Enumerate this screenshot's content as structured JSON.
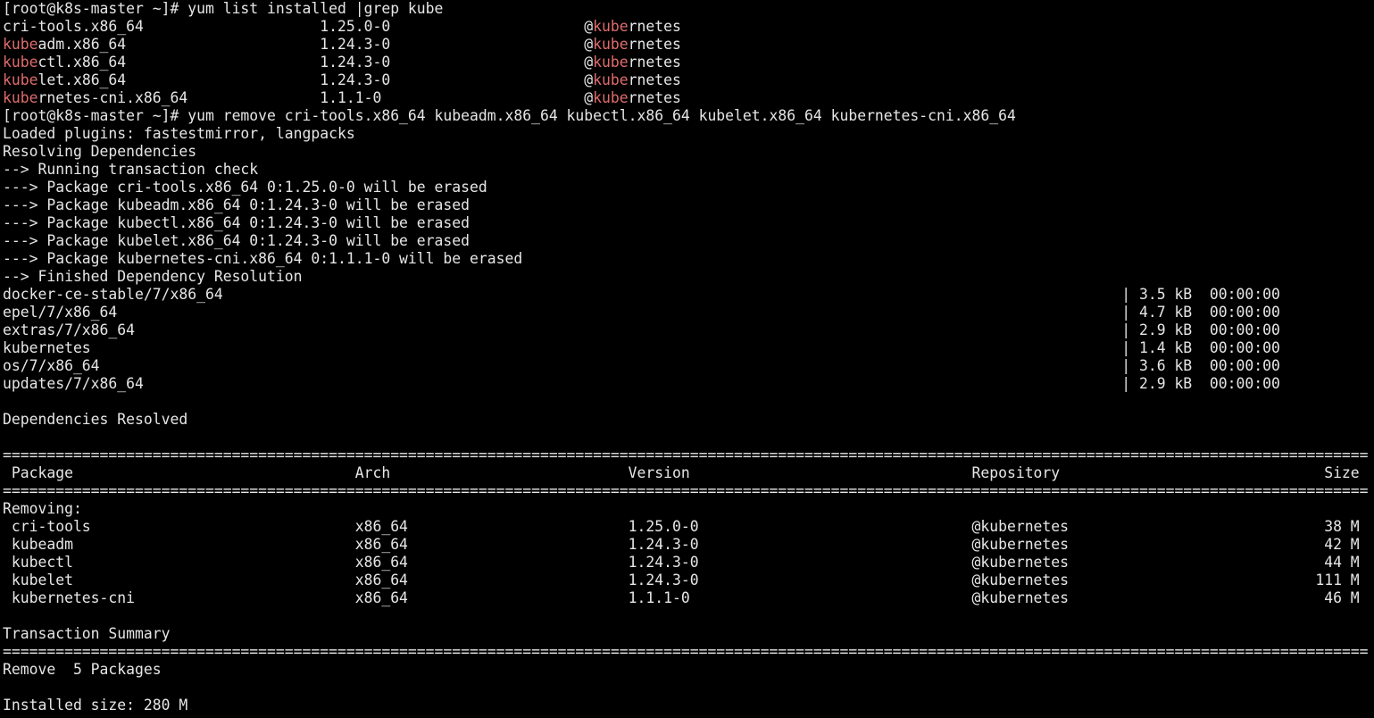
{
  "colors": {
    "background": "#000000",
    "text": "#e6e6e6",
    "grep_highlight": "#e06c6c"
  },
  "terminal": {
    "lines": [
      {
        "kind": "prompt",
        "text": "[root@k8s-master ~]# yum list installed |grep kube"
      },
      {
        "kind": "grep",
        "parts": [
          {
            "t": "cri-tools.x86_64                    1.25.0-0                      @"
          },
          {
            "t": "kube",
            "hl": true
          },
          {
            "t": "rnetes"
          }
        ]
      },
      {
        "kind": "grep",
        "parts": [
          {
            "t": "kube",
            "hl": true
          },
          {
            "t": "adm.x86_64                      1.24.3-0                      @"
          },
          {
            "t": "kube",
            "hl": true
          },
          {
            "t": "rnetes"
          }
        ]
      },
      {
        "kind": "grep",
        "parts": [
          {
            "t": "kube",
            "hl": true
          },
          {
            "t": "ctl.x86_64                      1.24.3-0                      @"
          },
          {
            "t": "kube",
            "hl": true
          },
          {
            "t": "rnetes"
          }
        ]
      },
      {
        "kind": "grep",
        "parts": [
          {
            "t": "kube",
            "hl": true
          },
          {
            "t": "let.x86_64                      1.24.3-0                      @"
          },
          {
            "t": "kube",
            "hl": true
          },
          {
            "t": "rnetes"
          }
        ]
      },
      {
        "kind": "grep",
        "parts": [
          {
            "t": "kube",
            "hl": true
          },
          {
            "t": "rnetes-cni.x86_64               1.1.1-0                       @"
          },
          {
            "t": "kube",
            "hl": true
          },
          {
            "t": "rnetes"
          }
        ]
      },
      {
        "kind": "prompt",
        "text": "[root@k8s-master ~]# yum remove cri-tools.x86_64 kubeadm.x86_64 kubectl.x86_64 kubelet.x86_64 kubernetes-cni.x86_64"
      },
      {
        "kind": "out",
        "text": "Loaded plugins: fastestmirror, langpacks"
      },
      {
        "kind": "out",
        "text": "Resolving Dependencies"
      },
      {
        "kind": "out",
        "text": "--> Running transaction check"
      },
      {
        "kind": "out",
        "text": "---> Package cri-tools.x86_64 0:1.25.0-0 will be erased"
      },
      {
        "kind": "out",
        "text": "---> Package kubeadm.x86_64 0:1.24.3-0 will be erased"
      },
      {
        "kind": "out",
        "text": "---> Package kubectl.x86_64 0:1.24.3-0 will be erased"
      },
      {
        "kind": "out",
        "text": "---> Package kubelet.x86_64 0:1.24.3-0 will be erased"
      },
      {
        "kind": "out",
        "text": "---> Package kubernetes-cni.x86_64 0:1.1.1-0 will be erased"
      },
      {
        "kind": "out",
        "text": "--> Finished Dependency Resolution"
      },
      {
        "kind": "repo",
        "text": "docker-ce-stable/7/x86_64                                                                                                      | 3.5 kB  00:00:00"
      },
      {
        "kind": "repo",
        "text": "epel/7/x86_64                                                                                                                  | 4.7 kB  00:00:00"
      },
      {
        "kind": "repo",
        "text": "extras/7/x86_64                                                                                                                | 2.9 kB  00:00:00"
      },
      {
        "kind": "repo",
        "text": "kubernetes                                                                                                                     | 1.4 kB  00:00:00"
      },
      {
        "kind": "repo",
        "text": "os/7/x86_64                                                                                                                    | 3.6 kB  00:00:00"
      },
      {
        "kind": "repo",
        "text": "updates/7/x86_64                                                                                                               | 2.9 kB  00:00:00"
      },
      {
        "kind": "blank",
        "text": ""
      },
      {
        "kind": "out",
        "text": "Dependencies Resolved"
      },
      {
        "kind": "blank",
        "text": ""
      },
      {
        "kind": "rule",
        "text": "==========================================================================================================================================================="
      },
      {
        "kind": "header",
        "text": " Package                                Arch                           Version                                Repository                              Size"
      },
      {
        "kind": "rule",
        "text": "==========================================================================================================================================================="
      },
      {
        "kind": "out",
        "text": "Removing:"
      },
      {
        "kind": "row",
        "text": " cri-tools                              x86_64                         1.25.0-0                               @kubernetes                             38 M"
      },
      {
        "kind": "row",
        "text": " kubeadm                                x86_64                         1.24.3-0                               @kubernetes                             42 M"
      },
      {
        "kind": "row",
        "text": " kubectl                                x86_64                         1.24.3-0                               @kubernetes                             44 M"
      },
      {
        "kind": "row",
        "text": " kubelet                                x86_64                         1.24.3-0                               @kubernetes                            111 M"
      },
      {
        "kind": "row",
        "text": " kubernetes-cni                         x86_64                         1.1.1-0                                @kubernetes                             46 M"
      },
      {
        "kind": "blank",
        "text": ""
      },
      {
        "kind": "out",
        "text": "Transaction Summary"
      },
      {
        "kind": "rule",
        "text": "==========================================================================================================================================================="
      },
      {
        "kind": "out",
        "text": "Remove  5 Packages"
      },
      {
        "kind": "blank",
        "text": ""
      },
      {
        "kind": "out",
        "text": "Installed size: 280 M"
      }
    ]
  }
}
